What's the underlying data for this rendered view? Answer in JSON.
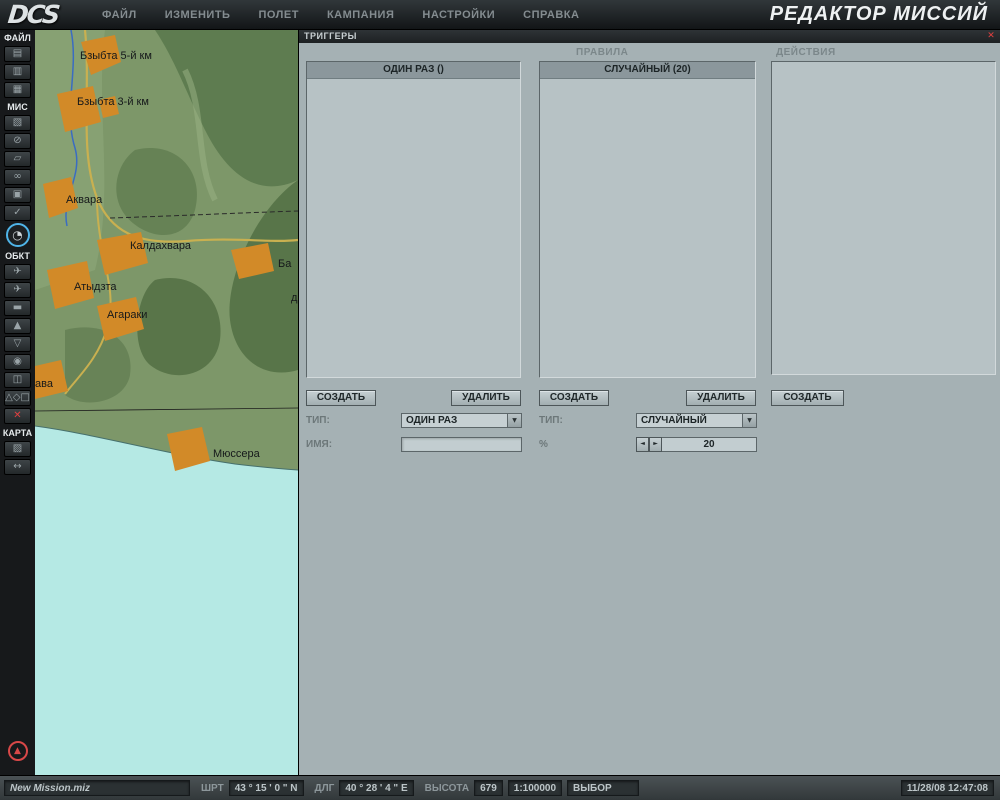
{
  "colors": {
    "accent_blue": "#4fb4e8",
    "panel_bg": "#a5b1b4",
    "sea": "#b5e9e4",
    "town_orange": "#d28a28",
    "alert_red": "#d84848"
  },
  "top_bar": {
    "logo": "DCS",
    "menus": [
      "ФАЙЛ",
      "ИЗМЕНИТЬ",
      "ПОЛЕТ",
      "КАМПАНИЯ",
      "НАСТРОЙКИ",
      "СПРАВКА"
    ],
    "title": "РЕДАКТОР МИССИЙ"
  },
  "sidebar": {
    "sections": [
      {
        "label": "ФАЙЛ",
        "items": [
          {
            "name": "new-mission",
            "glyph": "▤"
          },
          {
            "name": "open-mission",
            "glyph": "▥"
          },
          {
            "name": "save-mission",
            "glyph": "▦"
          }
        ]
      },
      {
        "label": "МИС",
        "items": [
          {
            "name": "briefing",
            "glyph": "▧"
          },
          {
            "name": "failures",
            "glyph": "⊘"
          },
          {
            "name": "payload",
            "glyph": "▱"
          },
          {
            "name": "route",
            "glyph": "∞"
          },
          {
            "name": "waypoints",
            "glyph": "▣"
          },
          {
            "name": "goals",
            "glyph": "✓"
          },
          {
            "name": "triggers",
            "glyph": "◔"
          }
        ]
      },
      {
        "label": "ОБКТ",
        "items": [
          {
            "name": "airplane",
            "glyph": "✈"
          },
          {
            "name": "helicopter",
            "glyph": "✈"
          },
          {
            "name": "ground-vehicle",
            "glyph": "▬"
          },
          {
            "name": "static-object",
            "glyph": "▲"
          },
          {
            "name": "ship",
            "glyph": "▽"
          },
          {
            "name": "submarine",
            "glyph": "◉"
          },
          {
            "name": "group",
            "glyph": "◫"
          },
          {
            "name": "templates",
            "glyph": "△◇□"
          },
          {
            "name": "delete-object",
            "glyph": "✕"
          }
        ]
      },
      {
        "label": "КАРТА",
        "items": [
          {
            "name": "map-layers",
            "glyph": "▨"
          },
          {
            "name": "ruler",
            "glyph": "↔"
          }
        ]
      }
    ],
    "eject_glyph": "▲"
  },
  "map": {
    "labels": [
      {
        "text": "Бзыбта 5-й км"
      },
      {
        "text": "Бзыбта 3-й км"
      },
      {
        "text": "Аквара"
      },
      {
        "text": "Калдахвара"
      },
      {
        "text": "Ба"
      },
      {
        "text": "Атыдзта"
      },
      {
        "text": "Агараки"
      },
      {
        "text": "д"
      },
      {
        "text": "ава"
      },
      {
        "text": "Мюссера"
      }
    ]
  },
  "panel": {
    "title": "ТРИГГЕРЫ",
    "close_label": "✕",
    "rules_label": "ПРАВИЛА",
    "actions_label": "ДЕЙСТВИЯ",
    "triggers_list": {
      "items": [
        {
          "text": "ОДИН РАЗ ()",
          "selected": true
        }
      ]
    },
    "rules_list": {
      "items": [
        {
          "text": "СЛУЧАЙНЫЙ (20)",
          "selected": true
        }
      ]
    },
    "actions_list": {
      "items": []
    },
    "buttons": {
      "create": "СОЗДАТЬ",
      "delete": "УДАЛИТЬ"
    },
    "trigger_form": {
      "type_label": "ТИП:",
      "type_value": "ОДИН РАЗ",
      "name_label": "ИМЯ:",
      "name_value": ""
    },
    "rule_form": {
      "type_label": "ТИП:",
      "type_value": "СЛУЧАЙНЫЙ",
      "percent_label": "%",
      "percent_value": "20"
    },
    "dropdown_arrow": "▼",
    "spin_left": "◄",
    "spin_right": "►"
  },
  "status_bar": {
    "filename": "New Mission.miz",
    "lat_label": "ШРТ",
    "lat_value": "43 ° 15 ' 0 \" N",
    "lon_label": "ДЛГ",
    "lon_value": "40 ° 28 ' 4 \" E",
    "alt_label": "ВЫСОТА",
    "alt_value": "679",
    "scale": "1:100000",
    "mode": "ВЫБОР",
    "datetime": "11/28/08 12:47:08"
  }
}
